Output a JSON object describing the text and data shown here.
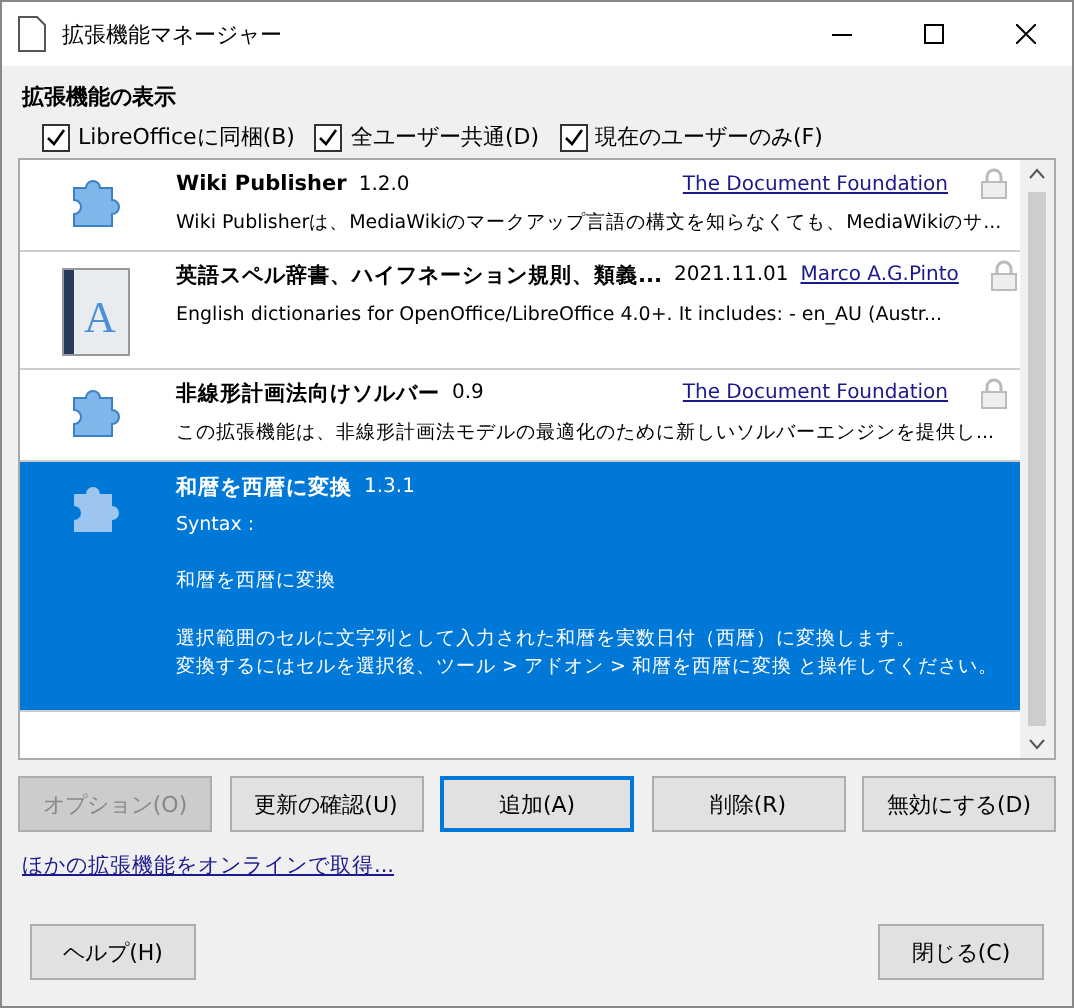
{
  "window": {
    "title": "拡張機能マネージャー"
  },
  "filter": {
    "label": "拡張機能の表示",
    "options": [
      {
        "label": "LibreOfficeに同梱(B)",
        "checked": true
      },
      {
        "label": "全ユーザー共通(D)",
        "checked": true
      },
      {
        "label": "現在のユーザーのみ(F)",
        "checked": true
      }
    ]
  },
  "extensions": [
    {
      "kind": "puzzle",
      "name": "Wiki Publisher",
      "version": "1.2.0",
      "publisher": "The Document Foundation",
      "locked": true,
      "selected": false,
      "description": [
        [
          "Wiki Publisherは、MediaWikiのマークアップ言語の構文を知らなくても、MediaWikiのサ..."
        ]
      ]
    },
    {
      "kind": "book",
      "cover_letter": "A",
      "name": "英語スペル辞書、ハイフネーション規則、類義...",
      "version": "2021.11.01",
      "publisher": "Marco A.G.Pinto",
      "locked": true,
      "selected": false,
      "description": [
        [
          "English dictionaries for OpenOffice/LibreOffice 4.0+.  It includes: - en_AU (Austr..."
        ]
      ]
    },
    {
      "kind": "puzzle",
      "name": "非線形計画法向けソルバー",
      "version": "0.9",
      "publisher": "The Document Foundation",
      "locked": true,
      "selected": false,
      "description": [
        [
          "この拡張機能は、非線形計画法モデルの最適化のために新しいソルバーエンジンを提供し..."
        ]
      ]
    },
    {
      "kind": "puzzle",
      "name": "和暦を西暦に変換",
      "version": "1.3.1",
      "locked": false,
      "selected": true,
      "description": [
        [
          "Syntax :"
        ],
        [
          "和暦を西暦に変換"
        ],
        [
          "選択範囲のセルに文字列として入力された和暦を実数日付（西暦）に変換します。",
          "変換するにはセルを選択後、ツール > アドオン > 和暦を西暦に変換 と操作してください。"
        ]
      ]
    }
  ],
  "actions": [
    {
      "label": "オプション(O)",
      "disabled": true,
      "focused": false
    },
    {
      "label": "更新の確認(U)",
      "disabled": false,
      "focused": false
    },
    {
      "label": "追加(A)",
      "disabled": false,
      "focused": true
    },
    {
      "label": "削除(R)",
      "disabled": false,
      "focused": false
    },
    {
      "label": "無効にする(D)",
      "disabled": false,
      "focused": false
    }
  ],
  "online_link": "ほかの拡張機能をオンラインで取得...",
  "footer": {
    "help": "ヘルプ(H)",
    "close": "閉じる(C)"
  }
}
